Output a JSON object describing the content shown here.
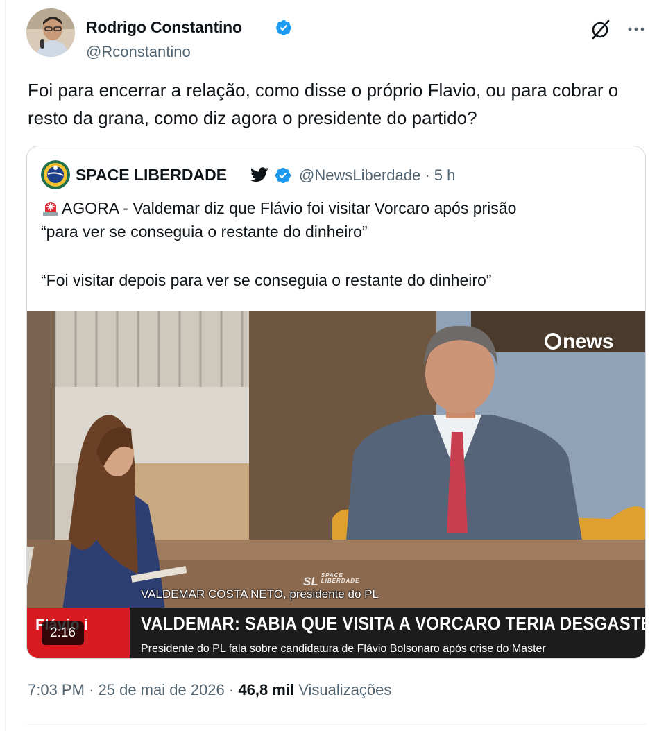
{
  "author": {
    "name": "Rodrigo Constantino",
    "handle": "@Rconstantino",
    "verified": true
  },
  "tweet": {
    "text": "Foi para encerrar a relação, como disse o próprio Flavio, ou para cobrar o resto da grana, como diz agora o presidente do partido?"
  },
  "quote": {
    "name": "SPACE LIBERDADE",
    "handle": "@NewsLiberdade",
    "separator": "·",
    "time": "5 h",
    "line1": "AGORA - Valdemar diz que Flávio foi visitar Vorcaro após prisão",
    "line2": "“para ver se conseguia o restante do dinheiro”",
    "line3": "“Foi visitar depois para ver se conseguia o restante do dinheiro”",
    "video": {
      "duration": "2:16",
      "logo_text": "news",
      "watermark": "SL",
      "watermark_small": "SPACE LIBERDADE",
      "caption": "VALDEMAR COSTA NETO, presidente do PL",
      "red_tag": "Flávio i",
      "headline": "VALDEMAR: SABIA QUE VISITA A VORCARO TERIA DESGASTE ELEITORAL",
      "subheadline": "Presidente do PL fala sobre candidatura de Flávio Bolsonaro após crise do Master"
    }
  },
  "meta": {
    "time": "7:03 PM",
    "sep1": "·",
    "date": "25 de mai de 2026",
    "sep2": "·",
    "views_count": "46,8 mil",
    "views_label": "Visualizações"
  },
  "icons": {
    "verified": "verified-badge-icon",
    "grok": "grok-icon",
    "more": "more-icon",
    "bird": "twitter-bird-icon",
    "siren": "rotating-light-emoji-icon"
  },
  "colors": {
    "verified_blue": "#1d9bf0",
    "secondary_text": "#536471",
    "lower_third_red": "#d71920"
  }
}
